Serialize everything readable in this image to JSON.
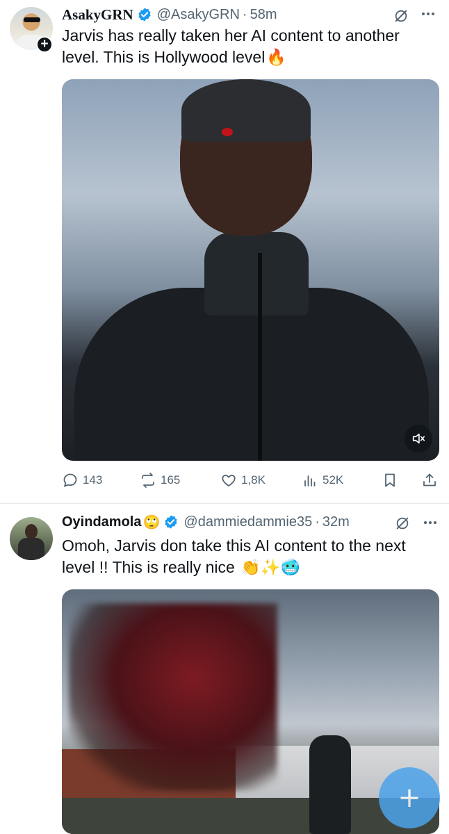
{
  "tweets": [
    {
      "display_name": "AsakyGRN",
      "handle": "@AsakyGRN",
      "separator": "·",
      "time": "58m",
      "text": "Jarvis has really taken her AI content to another level. This is Hollywood level",
      "text_emoji": "🔥",
      "media": {
        "type": "video",
        "muted": true
      },
      "actions": {
        "replies": "143",
        "reposts": "165",
        "likes": "1,8K",
        "views": "52K"
      }
    },
    {
      "display_name": "Oyindamola",
      "name_emoji": "🙄",
      "handle": "@dammiedammie35",
      "separator": "·",
      "time": "32m",
      "text": "Omoh, Jarvis don take this AI content to the next level !! This is really nice",
      "text_emoji": "👏✨🥶",
      "media": {
        "type": "video"
      }
    }
  ],
  "fab": {
    "icon": "plus-icon",
    "glyph": "+"
  },
  "colors": {
    "text_primary": "#0f1419",
    "text_secondary": "#536471",
    "verified_blue": "#1d9bf0",
    "fab_blue": "#4da3ea",
    "divider": "#e7e9ea"
  }
}
